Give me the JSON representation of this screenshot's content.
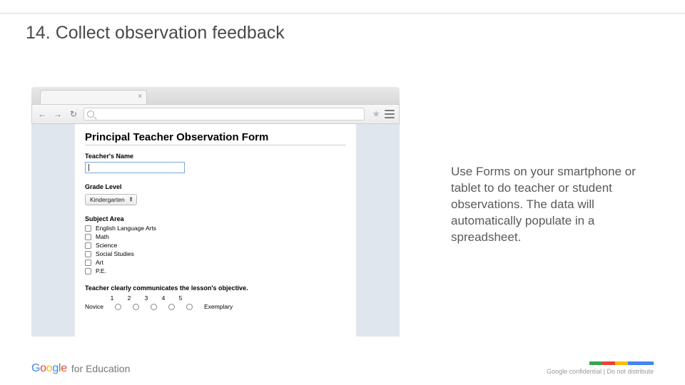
{
  "slide": {
    "heading": "14. Collect observation feedback",
    "body": "Use Forms on your smartphone or tablet to do teacher or student observations. The data will automatically populate in a spreadsheet."
  },
  "form": {
    "title": "Principal Teacher Observation Form",
    "q_teacher_name": "Teacher's Name",
    "q_grade_level": "Grade Level",
    "grade_level_value": "Kindergarten",
    "q_subject_area": "Subject Area",
    "subjects": [
      "English Language Arts",
      "Math",
      "Science",
      "Social Studies",
      "Art",
      "P.E."
    ],
    "q_objective": "Teacher clearly communicates the lesson's objective.",
    "scale_nums": [
      "1",
      "2",
      "3",
      "4",
      "5"
    ],
    "scale_low": "Novice",
    "scale_high": "Exemplary"
  },
  "footer": {
    "brand_suffix": "for Education",
    "confidential": "Google confidential | Do not distribute"
  }
}
